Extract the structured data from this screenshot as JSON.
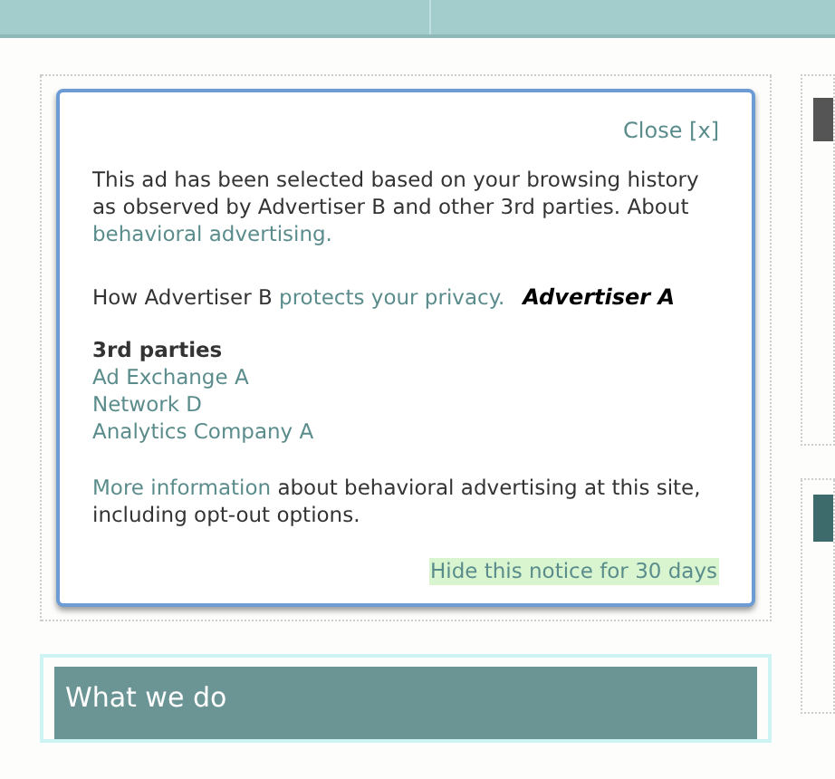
{
  "notice": {
    "close": "Close [x]",
    "intro": {
      "text": "This ad has been selected based on your browsing history as observed by Advertiser B and other 3rd parties. About ",
      "link": "behavioral advertising."
    },
    "privacy": {
      "text": "How Advertiser B ",
      "link": "protects your privacy."
    },
    "advertiser_logo": "Advertiser A",
    "third_parties": {
      "heading": "3rd parties",
      "items": [
        "Ad Exchange A",
        "Network D",
        "Analytics Company A"
      ]
    },
    "more": {
      "link": "More information",
      "text": " about behavioral advertising at this site, including opt-out options."
    },
    "hide": "Hide this notice for 30 days"
  },
  "section": {
    "title": "What we do"
  }
}
